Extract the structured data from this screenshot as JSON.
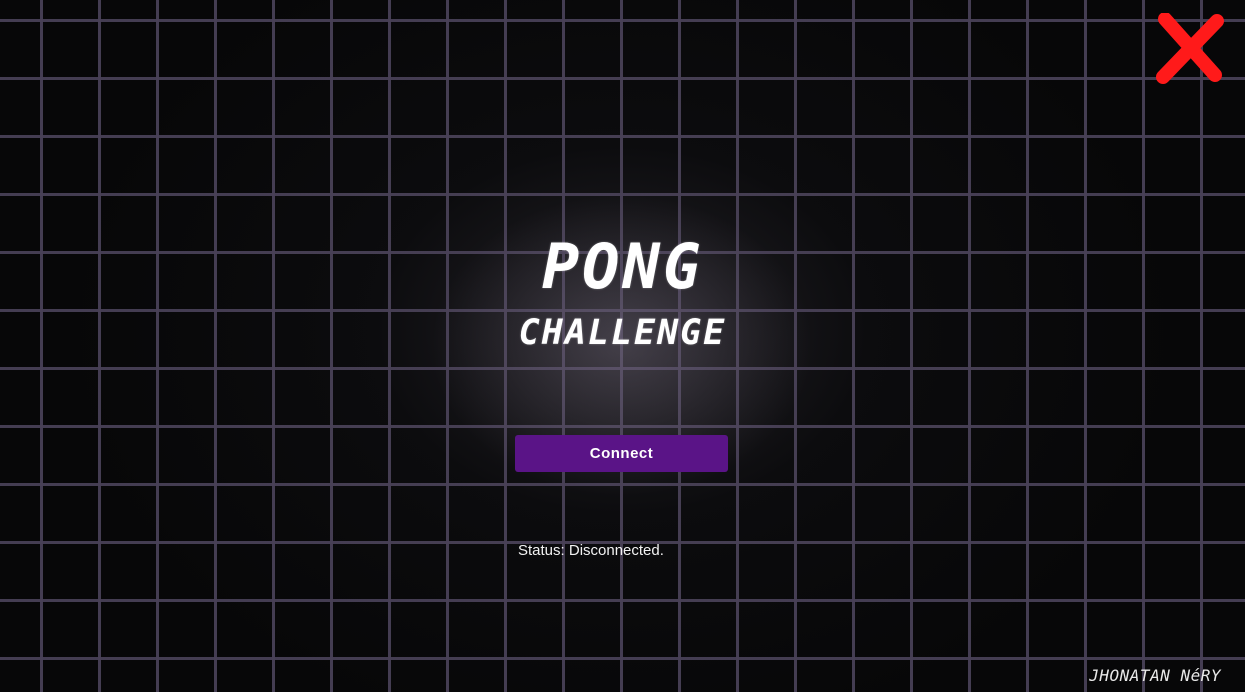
{
  "title": {
    "main": "PONG",
    "sub": "CHALLENGE"
  },
  "connect_button": {
    "label": "Connect",
    "color": "#5a1487"
  },
  "status": {
    "text": "Status: Disconnected."
  },
  "credit": {
    "text": "JHONATAN NéRY"
  },
  "icons": {
    "close": "close-icon",
    "close_color": "#ff1a1a"
  }
}
